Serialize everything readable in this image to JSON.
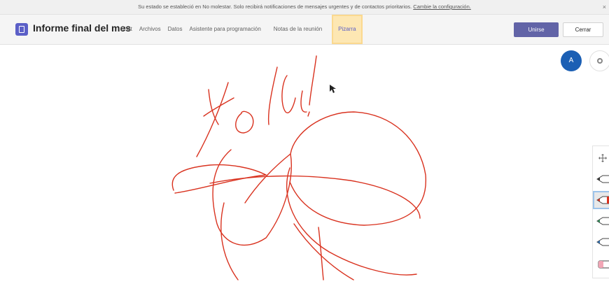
{
  "notice": {
    "text": "Su estado se estableció en No molestar. Solo recibirá notificaciones de mensajes urgentes y de contactos prioritarios.",
    "link": "Cambie la configuración.",
    "close": "×"
  },
  "header": {
    "title": "Informe final del mes",
    "tabs": [
      "Chat",
      "Archivos",
      "Datos",
      "Asistente para programación",
      "Notas de la reunión",
      "Pizarra"
    ],
    "join_label": "Unirse",
    "close_label": "Cerrar"
  },
  "avatar": {
    "initial": "A"
  },
  "colors": {
    "accent": "#6264a7",
    "ink": "#d9321f",
    "highlight": "#fde7b3"
  },
  "toolbar": {
    "tools": [
      {
        "icon": "move-icon"
      },
      {
        "icon": "black-pen-icon",
        "color": "#333333"
      },
      {
        "icon": "red-pen-icon",
        "color": "#d9321f",
        "selected": true
      },
      {
        "icon": "green-pen-icon",
        "color": "#2e8b57"
      },
      {
        "icon": "blue-pen-icon",
        "color": "#2b6cb0"
      },
      {
        "icon": "eraser-icon",
        "color": "#f2a6b6"
      }
    ]
  }
}
